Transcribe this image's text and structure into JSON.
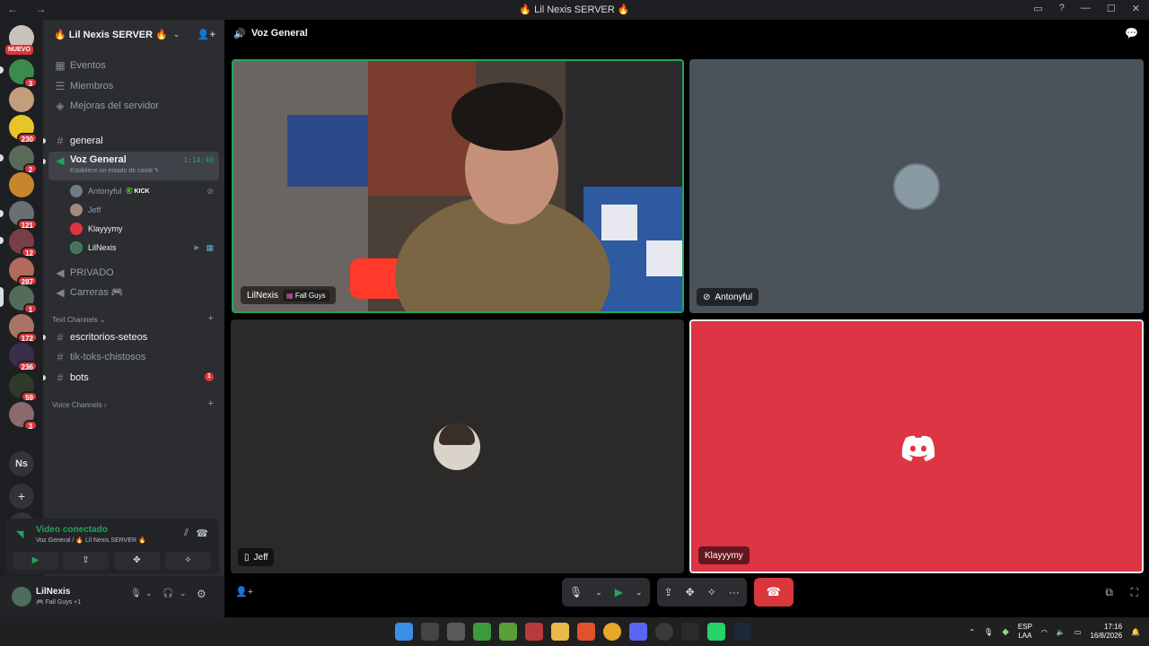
{
  "window": {
    "nav": "← →",
    "title": "🔥 Lil Nexis SERVER 🔥",
    "controls": [
      "▭",
      "?",
      "—",
      "☐",
      "✕"
    ]
  },
  "server_rail": {
    "new_badge": "NUEVO",
    "badges": [
      "3",
      "230",
      "2",
      "121",
      "12",
      "287",
      "1",
      "172",
      "236",
      "59",
      "3"
    ],
    "folder_label": "Ns",
    "add_icon": "+",
    "discover_icon": "⊙"
  },
  "server": {
    "name": "🔥 Lil Nexis SERVER 🔥",
    "chevron": "⌄",
    "invite_icon": "👤+"
  },
  "menu_items": [
    {
      "icon": "calendar-icon",
      "label": "Eventos"
    },
    {
      "icon": "members-icon",
      "label": "Miembros"
    },
    {
      "icon": "boost-icon",
      "label": "Mejoras del servidor"
    }
  ],
  "channels": {
    "general": "general",
    "voice_general": "Voz General",
    "voice_status": "Establece un estado de canal ✎",
    "voice_timer": "1:14:40",
    "privado": "PRIVADO",
    "carreras": "Carreras 🎮",
    "text_category": "Text Channels ⌄",
    "escritorios": "escritorios-seteos",
    "tiktoks": "tik-toks-chistosos",
    "bots": "bots",
    "bots_badge": "1",
    "voice_category": "Voice Channels ›"
  },
  "voice_users": [
    {
      "name": "Antonyful",
      "tag": "KICK",
      "kick_logo": "Ⓚ",
      "muted_icon": "⊘"
    },
    {
      "name": "Jeff"
    },
    {
      "name": "Klayyymy"
    },
    {
      "name": "LilNexis",
      "camera_icon": "▶",
      "game_icon": "▦"
    }
  ],
  "voice_connection": {
    "status": "Video conectado",
    "location": "Voz General / 🔥 Lil Nexis SERVER 🔥",
    "noise_icon": "⫽",
    "disconnect_icon": "☎"
  },
  "user_panel": {
    "name": "LilNexis",
    "status": "🎮 Fall Guys +1",
    "mic_icon": "🎙",
    "dropdown_icon": "⌄",
    "headset_icon": "🎧",
    "settings_icon": "⚙"
  },
  "call": {
    "channel": "Voz General",
    "channel_icon": "🔊",
    "threads_icon": "💬",
    "tiles": [
      {
        "name": "LilNexis",
        "game": "Fall Guys"
      },
      {
        "name": "Antonyful",
        "muted_icon": "⊘"
      },
      {
        "name": "Jeff",
        "mobile_icon": "▯"
      },
      {
        "name": "Klayyymy"
      }
    ],
    "activity_icon": "👤+",
    "popout_icon": "⧉",
    "fullscreen_icon": "⛶",
    "toolbar": {
      "mic_icon": "🎙",
      "dropdown_icon": "⌄",
      "camera_icon": "▶",
      "screen_share_icon": "⇪",
      "activities_icon": "✥",
      "soundboard_icon": "✧",
      "more_icon": "···",
      "hangup_icon": "☎"
    }
  },
  "taskbar": {
    "language": "ESP",
    "layout": "LAA",
    "time": "17:16",
    "date": "16/8/2026",
    "tray_up": "⌃",
    "mic_icon": "🎙",
    "wifi_icon": "◠",
    "volume_icon": "🔈",
    "battery_icon": "▭",
    "notification_icon": "🔔"
  },
  "colors": {
    "discord_red": "#da373c",
    "discord_green": "#23a55a",
    "tile_klayyymy": "#dd3543",
    "tile_antonyful": "#4a5359",
    "tile_jeff": "#2b2a28"
  }
}
